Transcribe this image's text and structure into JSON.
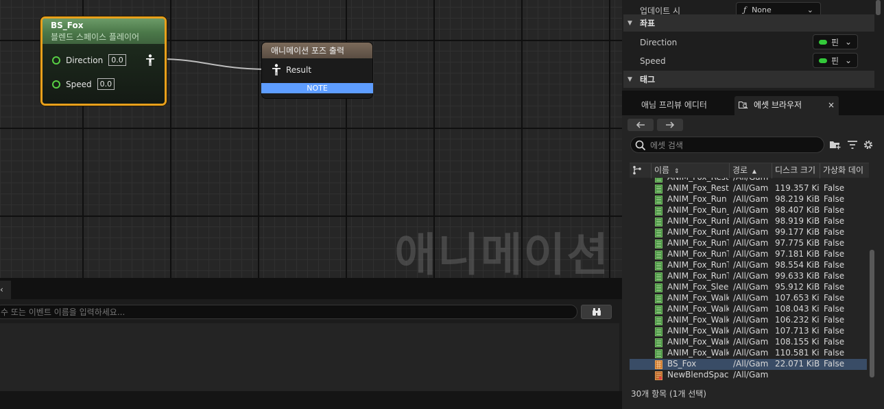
{
  "graph": {
    "watermark": "애니메이션",
    "blend_node": {
      "title": "BS_Fox",
      "subtitle": "블렌드 스페이스 플레이어",
      "pins": [
        {
          "label": "Direction",
          "value": "0.0"
        },
        {
          "label": "Speed",
          "value": "0.0"
        }
      ]
    },
    "output_node": {
      "title": "애니메이션 포즈 출력",
      "pin_label": "Result",
      "note": "NOTE"
    }
  },
  "find_panel": {
    "tab_label": "‹",
    "placeholder": "수 또는 이벤트 이름을 입력하세요...",
    "find_icon": "binoculars-icon"
  },
  "details": {
    "update_label": "업데이트 시",
    "update_value": "None",
    "category_coords": "좌표",
    "direction_label": "Direction",
    "speed_label": "Speed",
    "pin_value": "핀",
    "category_tags": "태그"
  },
  "tabs": {
    "anim_preview": "애님 프리뷰 에디터",
    "asset_browser": "에셋 브라우저",
    "close": "×"
  },
  "asset_browser": {
    "search_placeholder": "에셋 검색",
    "columns": {
      "name": "이름",
      "path": "경로",
      "disk_size": "디스크 크기",
      "virtualized": "가상화 데이"
    },
    "rows": [
      {
        "name": "ANIM_Fox_Rest",
        "path": "/All/Gam",
        "size": "",
        "virt": "",
        "type": "anim"
      },
      {
        "name": "ANIM_Fox_Rest",
        "path": "/All/Gam",
        "size": "119.357 Ki",
        "virt": "False",
        "type": "anim"
      },
      {
        "name": "ANIM_Fox_Run",
        "path": "/All/Gam",
        "size": "98.219 KiB",
        "virt": "False",
        "type": "anim"
      },
      {
        "name": "ANIM_Fox_Run_",
        "path": "/All/Gam",
        "size": "98.407 KiB",
        "virt": "False",
        "type": "anim"
      },
      {
        "name": "ANIM_Fox_RunE",
        "path": "/All/Gam",
        "size": "98.919 KiB",
        "virt": "False",
        "type": "anim"
      },
      {
        "name": "ANIM_Fox_RunE",
        "path": "/All/Gam",
        "size": "99.177 KiB",
        "virt": "False",
        "type": "anim"
      },
      {
        "name": "ANIM_Fox_RunT",
        "path": "/All/Gam",
        "size": "97.775 KiB",
        "virt": "False",
        "type": "anim"
      },
      {
        "name": "ANIM_Fox_RunT",
        "path": "/All/Gam",
        "size": "97.181 KiB",
        "virt": "False",
        "type": "anim"
      },
      {
        "name": "ANIM_Fox_RunT",
        "path": "/All/Gam",
        "size": "98.554 KiB",
        "virt": "False",
        "type": "anim"
      },
      {
        "name": "ANIM_Fox_RunT",
        "path": "/All/Gam",
        "size": "99.633 KiB",
        "virt": "False",
        "type": "anim"
      },
      {
        "name": "ANIM_Fox_Slee",
        "path": "/All/Gam",
        "size": "95.912 KiB",
        "virt": "False",
        "type": "anim"
      },
      {
        "name": "ANIM_Fox_Walk",
        "path": "/All/Gam",
        "size": "107.653 Ki",
        "virt": "False",
        "type": "anim"
      },
      {
        "name": "ANIM_Fox_Walk",
        "path": "/All/Gam",
        "size": "108.043 Ki",
        "virt": "False",
        "type": "anim"
      },
      {
        "name": "ANIM_Fox_Walk",
        "path": "/All/Gam",
        "size": "106.232 Ki",
        "virt": "False",
        "type": "anim"
      },
      {
        "name": "ANIM_Fox_Walk",
        "path": "/All/Gam",
        "size": "107.713 Ki",
        "virt": "False",
        "type": "anim"
      },
      {
        "name": "ANIM_Fox_Walk",
        "path": "/All/Gam",
        "size": "108.155 Ki",
        "virt": "False",
        "type": "anim"
      },
      {
        "name": "ANIM_Fox_Walk",
        "path": "/All/Gam",
        "size": "110.581 Ki",
        "virt": "False",
        "type": "anim"
      },
      {
        "name": "BS_Fox",
        "path": "/All/Gam",
        "size": "22.071 KiB",
        "virt": "False",
        "type": "blendspace",
        "selected": true
      },
      {
        "name": "NewBlendSpace",
        "path": "/All/Gam",
        "size": "",
        "virt": "",
        "type": "blendspace_new"
      }
    ],
    "status": "30개 항목 (1개 선택)"
  },
  "colors": {
    "accent_orange": "#e8a01c",
    "pin_green": "#58d044",
    "note_blue": "#5e9dff",
    "selection": "#394c66"
  }
}
